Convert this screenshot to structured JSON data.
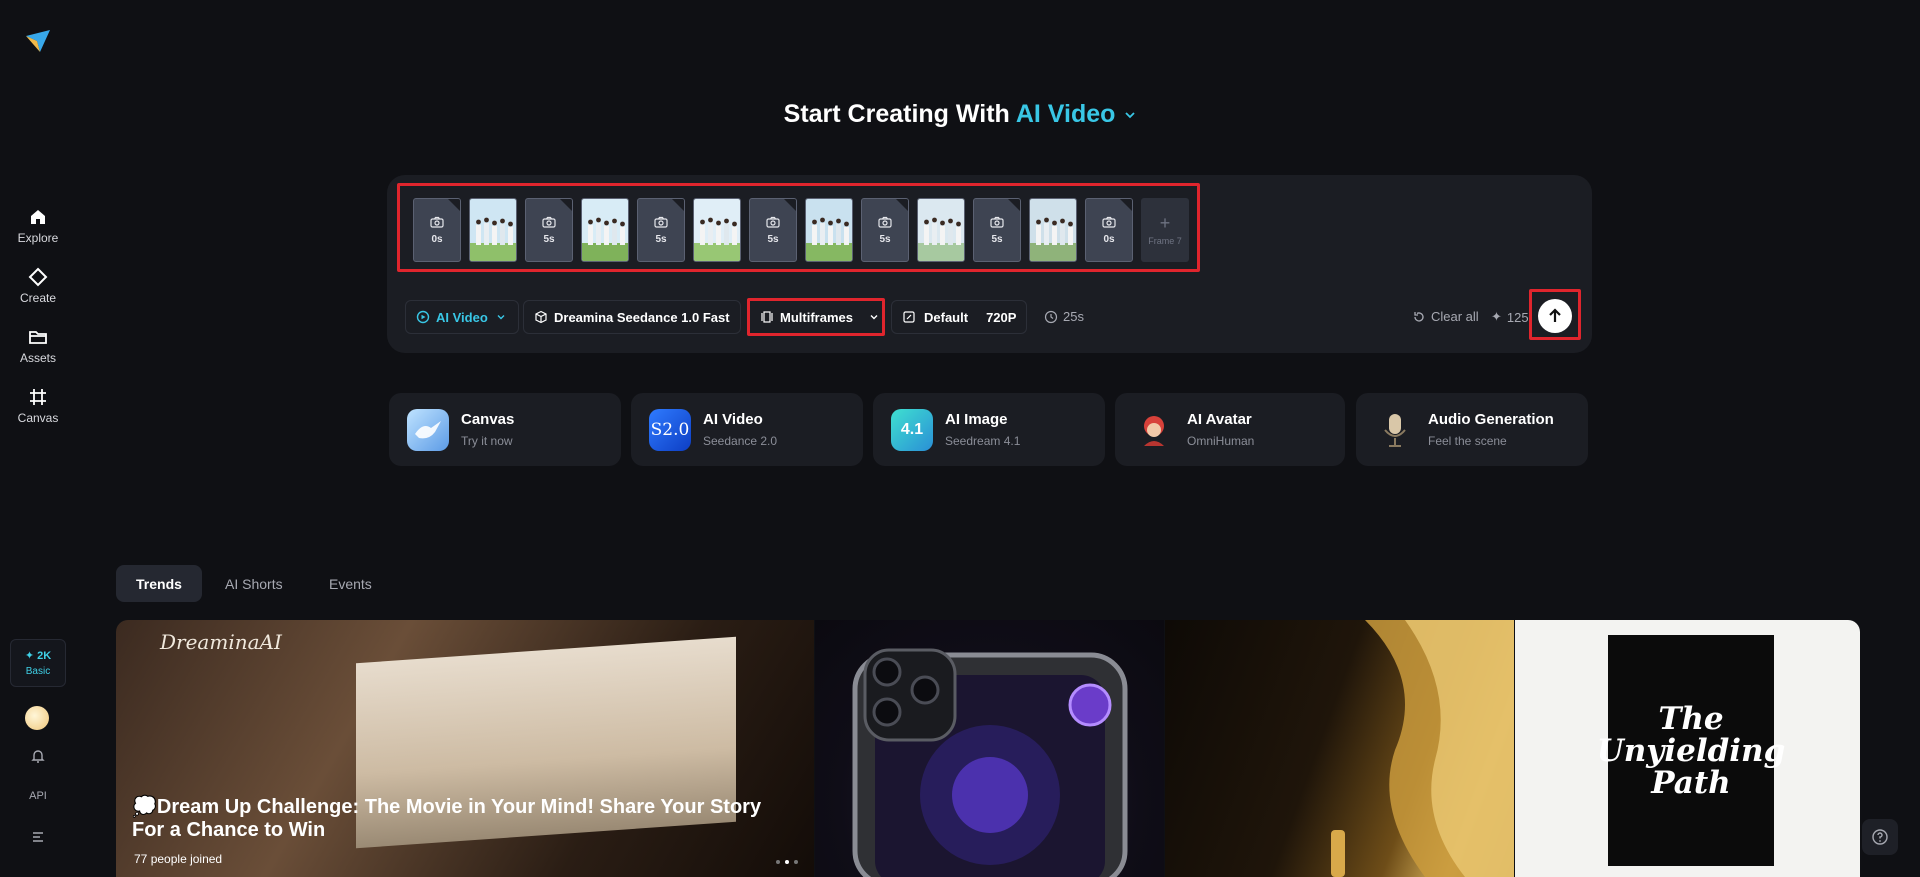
{
  "sidebar": {
    "items": [
      {
        "label": "Explore",
        "icon": "home-icon"
      },
      {
        "label": "Create",
        "icon": "diamond-icon"
      },
      {
        "label": "Assets",
        "icon": "folder-icon"
      },
      {
        "label": "Canvas",
        "icon": "crop-icon"
      }
    ],
    "credits": {
      "amount": "✦ 2K",
      "plan": "Basic"
    },
    "api_label": "API"
  },
  "hero": {
    "title_prefix": "Start Creating With",
    "title_accent": "AI Video"
  },
  "frames": {
    "slots": [
      {
        "type": "empty",
        "duration": "0s"
      },
      {
        "type": "image"
      },
      {
        "type": "empty",
        "duration": "5s"
      },
      {
        "type": "image"
      },
      {
        "type": "empty",
        "duration": "5s"
      },
      {
        "type": "image"
      },
      {
        "type": "empty",
        "duration": "5s"
      },
      {
        "type": "image"
      },
      {
        "type": "empty",
        "duration": "5s"
      },
      {
        "type": "image"
      },
      {
        "type": "empty",
        "duration": "5s"
      },
      {
        "type": "image"
      },
      {
        "type": "empty",
        "duration": "0s"
      }
    ],
    "add_label": "Frame 7"
  },
  "toolbar": {
    "mode": "AI Video",
    "model": "Dreamina Seedance 1.0 Fast",
    "type": "Multiframes",
    "ratio": "Default",
    "resolution": "720P",
    "duration": "25s",
    "clear_label": "Clear all",
    "cost": "125"
  },
  "features": [
    {
      "title": "Canvas",
      "subtitle": "Try it now"
    },
    {
      "title": "AI Video",
      "subtitle": "Seedance 2.0",
      "badge": "S2.0"
    },
    {
      "title": "AI Image",
      "subtitle": "Seedream 4.1",
      "badge": "4.1"
    },
    {
      "title": "AI Avatar",
      "subtitle": "OmniHuman"
    },
    {
      "title": "Audio Generation",
      "subtitle": "Feel the scene"
    }
  ],
  "tabs": [
    "Trends",
    "AI Shorts",
    "Events"
  ],
  "gallery": {
    "featured": {
      "brand": "DreaminaAI",
      "title": "💭Dream Up Challenge: The Movie in Your Mind! Share Your Story For a Chance to Win",
      "joined_count": "77",
      "joined_label": "people joined"
    },
    "poster_text": "The Unyielding Path"
  },
  "colors": {
    "accent": "#39c7e6",
    "highlight_box": "#e0252d",
    "background": "#0f1014",
    "panel": "#1b1d23"
  }
}
